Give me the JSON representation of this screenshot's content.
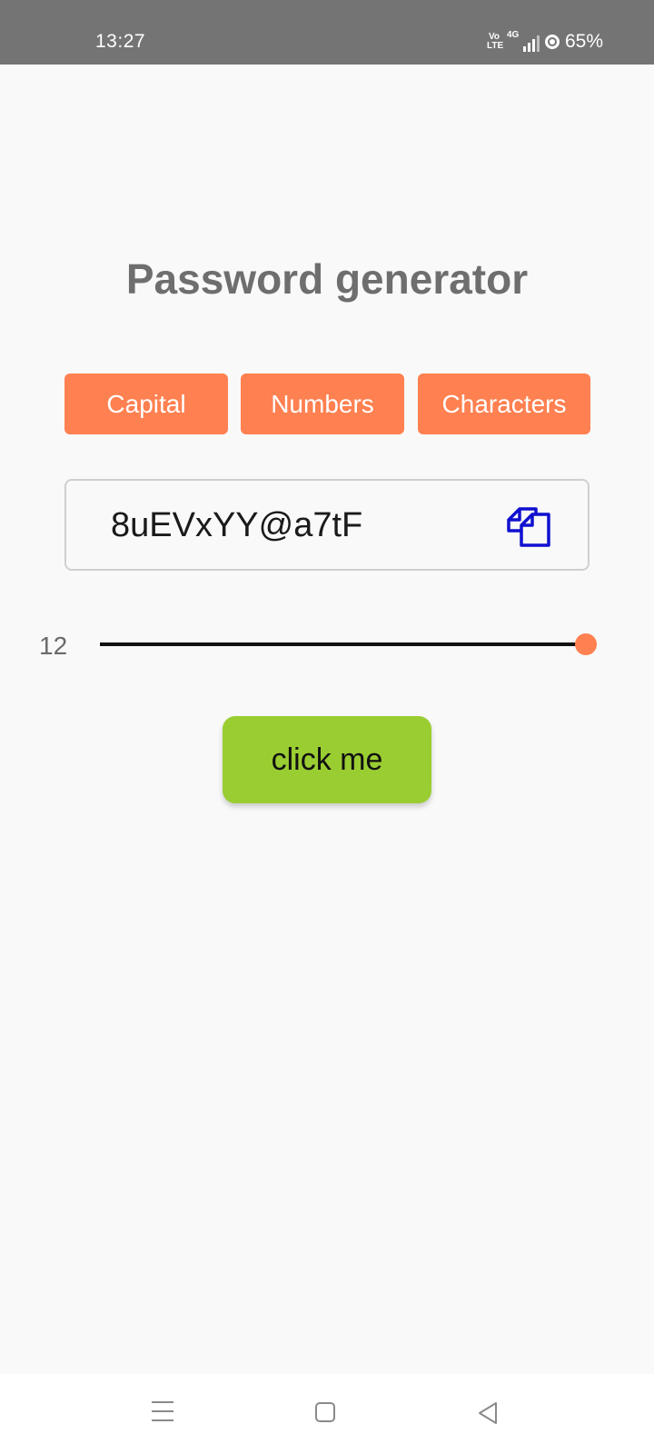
{
  "status_bar": {
    "time": "13:27",
    "volte_label": "Vo\nLTE",
    "network_label": "4G",
    "battery": "65%"
  },
  "app": {
    "title": "Password generator",
    "options": [
      {
        "label": "Capital"
      },
      {
        "label": "Numbers"
      },
      {
        "label": "Characters"
      }
    ],
    "password": "8uEVxYY@a7tF",
    "length_value": "12",
    "length_fraction": 1.0,
    "generate_button_label": "click me"
  },
  "colors": {
    "accent": "#ff8050",
    "action": "#9acd32",
    "copy_icon": "#1010d0"
  },
  "icons": {
    "copy": "copy-icon",
    "nav_menu": "menu-icon",
    "nav_home": "home-icon",
    "nav_back": "back-icon"
  }
}
